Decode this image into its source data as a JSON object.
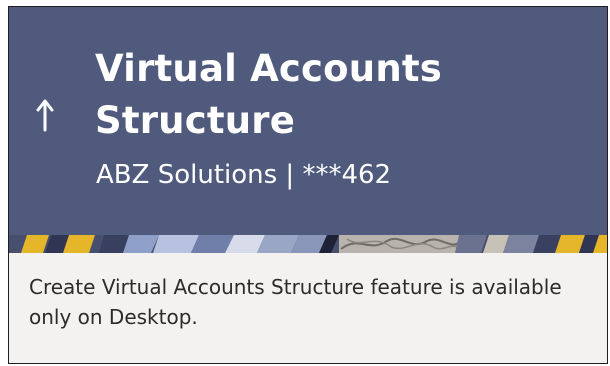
{
  "header": {
    "back_icon": "up-arrow-icon",
    "title": "Virtual Accounts Structure",
    "subtitle": "ABZ Solutions | ***462"
  },
  "message": {
    "text": "Create Virtual Accounts Structure feature is available only on Desktop."
  },
  "colors": {
    "header_background": "#4f5a7d",
    "pattern_yellow": "#e5b52a",
    "page_background": "#f3f2f0",
    "text": "#2b2b2b"
  }
}
